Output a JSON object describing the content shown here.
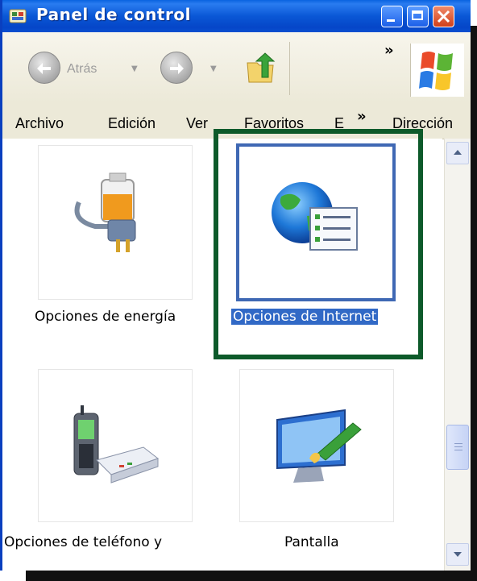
{
  "window": {
    "title": "Panel de control",
    "title_color": "#0a57d6"
  },
  "toolbar": {
    "back_label": "Atrás",
    "overflow_chevron": "»"
  },
  "menubar": {
    "items": [
      "Archivo",
      "Edición",
      "Ver",
      "Favoritos",
      "E"
    ],
    "overflow_chevron": "»",
    "address_label": "Dirección"
  },
  "items": [
    {
      "label": "Opciones de energía",
      "icon": "power-options-icon",
      "selected": false
    },
    {
      "label": "Opciones de Internet",
      "icon": "internet-options-icon",
      "selected": true
    },
    {
      "label": "Opciones de teléfono y",
      "icon": "phone-modem-icon",
      "selected": false
    },
    {
      "label": "Pantalla",
      "icon": "display-icon",
      "selected": false
    }
  ],
  "colors": {
    "highlight_border": "#0d5a2a",
    "selection": "#3169c6"
  }
}
